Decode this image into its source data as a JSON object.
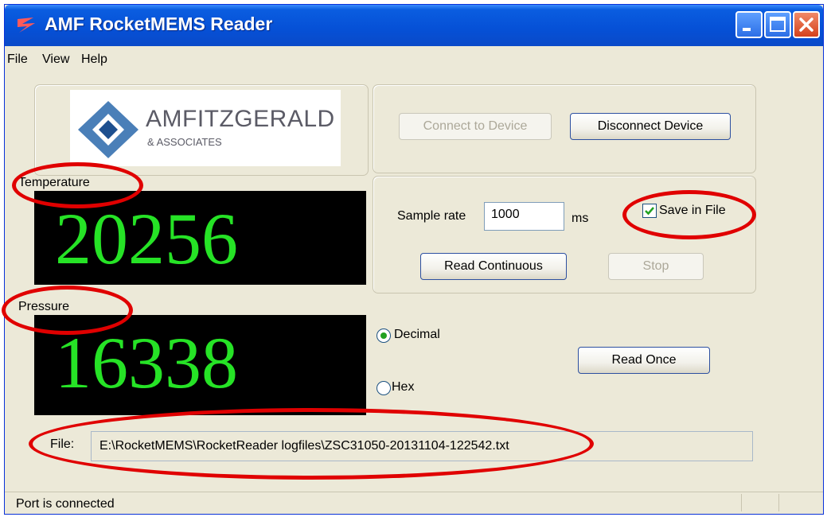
{
  "window": {
    "title": "AMF RocketMEMS Reader"
  },
  "menu": {
    "items": [
      "File",
      "View",
      "Help"
    ]
  },
  "logo": {
    "name": "AMFITZGERALD",
    "sub": "& ASSOCIATES"
  },
  "device": {
    "connect_label": "Connect to Device",
    "disconnect_label": "Disconnect Device"
  },
  "temperature": {
    "label": "Temperature",
    "value": "20256"
  },
  "pressure": {
    "label": "Pressure",
    "value": "16338"
  },
  "sampling": {
    "rate_label": "Sample rate",
    "rate_value": "1000",
    "rate_unit": "ms",
    "save_label": "Save in File",
    "save_checked": true,
    "read_continuous_label": "Read Continuous",
    "stop_label": "Stop"
  },
  "format": {
    "decimal_label": "Decimal",
    "hex_label": "Hex",
    "selected": "Decimal"
  },
  "read_once_label": "Read Once",
  "file": {
    "label": "File:",
    "path": "E:\\RocketMEMS\\RocketReader logfiles\\ZSC31050-20131104-122542.txt"
  },
  "status": {
    "text": "Port is connected"
  },
  "colors": {
    "display_digits": "#26e326",
    "highlight": "#e00000",
    "titlebar": "#0650d6"
  }
}
